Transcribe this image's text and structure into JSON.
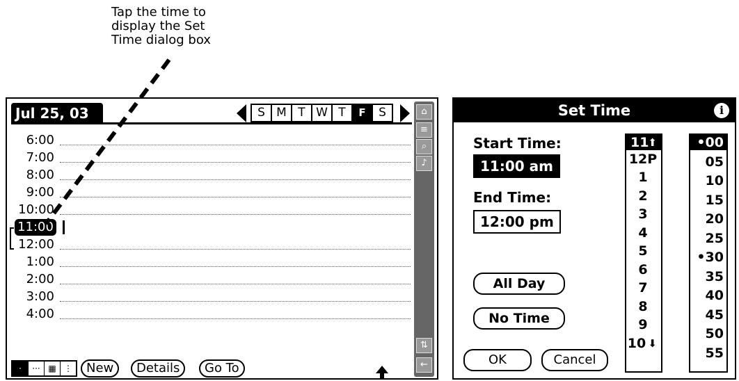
{
  "callout": {
    "lines": [
      "Tap the time to",
      "display the Set",
      "Time dialog box"
    ]
  },
  "day_view": {
    "date_label": "Jul 25, 03",
    "week_days": [
      "S",
      "M",
      "T",
      "W",
      "T",
      "F",
      "S"
    ],
    "selected_day_index": 5,
    "time_slots": [
      "6:00",
      "7:00",
      "8:00",
      "9:00",
      "10:00",
      "11:00",
      "12:00",
      "1:00",
      "2:00",
      "3:00",
      "4:00"
    ],
    "highlighted_slot_index": 5,
    "sidebar_icons": [
      "home-icon",
      "menu-icon",
      "find-icon",
      "speaker-icon",
      "rotate-icon",
      "back-icon"
    ],
    "view_buttons": [
      "·",
      "···",
      "▦",
      "⋮"
    ],
    "new_label": "New",
    "details_label": "Details",
    "goto_label": "Go To"
  },
  "set_time": {
    "title": "Set Time",
    "start_label": "Start Time:",
    "start_value": "11:00 am",
    "end_label": "End Time:",
    "end_value": "12:00 pm",
    "all_day_label": "All Day",
    "no_time_label": "No Time",
    "ok_label": "OK",
    "cancel_label": "Cancel",
    "hours": [
      "11",
      "12P",
      "1",
      "2",
      "3",
      "4",
      "5",
      "6",
      "7",
      "8",
      "9",
      "10"
    ],
    "selected_hour_index": 0,
    "minutes": [
      "•00",
      "05",
      "10",
      "15",
      "20",
      "25",
      "•30",
      "35",
      "40",
      "45",
      "50",
      "55"
    ],
    "selected_minute_index": 0
  }
}
